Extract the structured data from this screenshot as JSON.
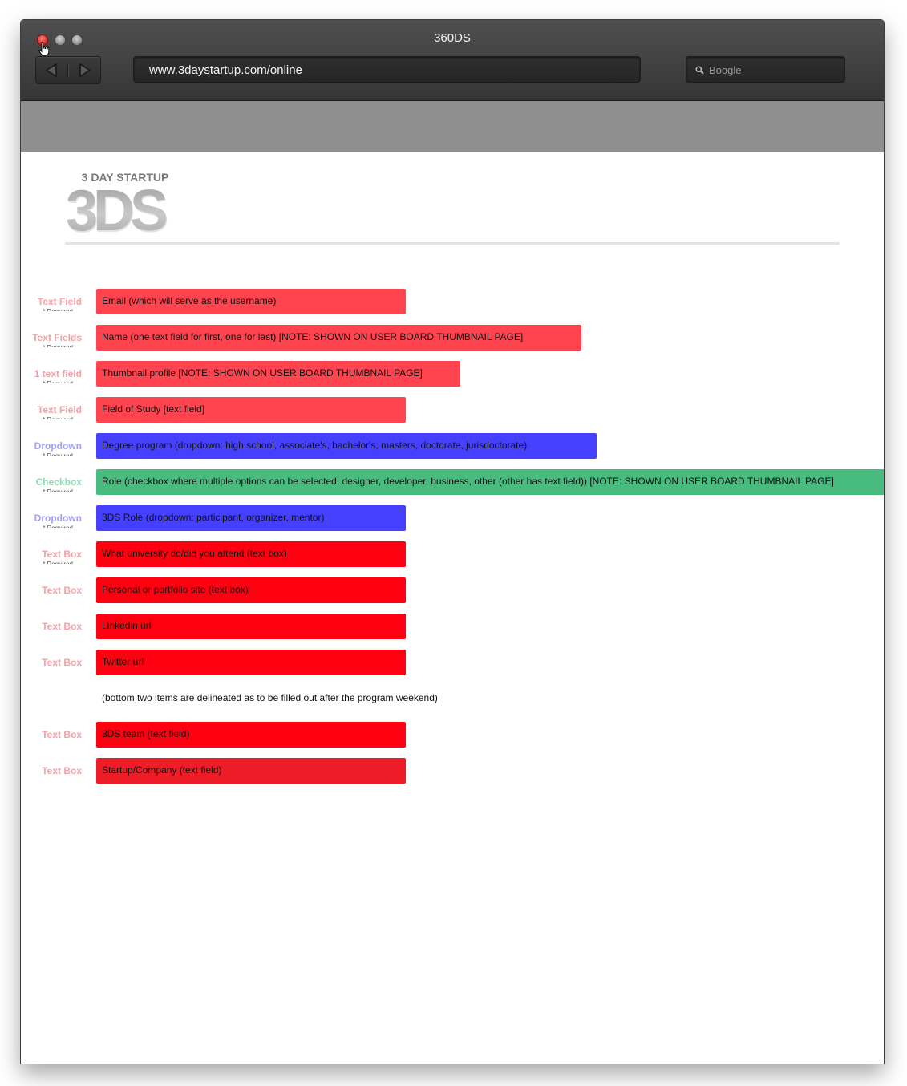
{
  "window": {
    "title": "360DS"
  },
  "toolbar": {
    "url": "www.3daystartup.com/online",
    "search_placeholder": "Boogle"
  },
  "logo": {
    "top_text": "3 DAY STARTUP",
    "main_text": "3DS"
  },
  "colors": {
    "red_light": "#ff4450",
    "red": "#ff0010",
    "red_dark": "#ee1c27",
    "blue": "#4540ff",
    "green": "#48bb7f",
    "label_red": "#f5a0a6",
    "label_blue": "#a4a0f6",
    "label_green": "#8fdcb0"
  },
  "form_fields": [
    {
      "type_label": "Text Field",
      "required": "* Required",
      "text": "Email (which will serve as the username)",
      "color": "#ff4450",
      "label_color": "#f5a0a6"
    },
    {
      "type_label": "Text Fields",
      "required": "* Required",
      "text": "Name (one text field for first, one for last) [NOTE: SHOWN ON USER BOARD THUMBNAIL PAGE]",
      "color": "#ff4450",
      "label_color": "#f5a0a6"
    },
    {
      "type_label": "1 text field",
      "required": "* Required",
      "text": "Thumbnail profile [NOTE: SHOWN ON USER BOARD THUMBNAIL PAGE]",
      "color": "#ff4450",
      "label_color": "#f5a0a6"
    },
    {
      "type_label": "Text Field",
      "required": "* Required",
      "text": "Field of Study [text field]",
      "color": "#ff4450",
      "label_color": "#f5a0a6"
    },
    {
      "type_label": "Dropdown",
      "required": "* Required",
      "text": "Degree program (dropdown: high school, associate's, bachelor's, masters, doctorate, jurisdoctorate)",
      "color": "#4540ff",
      "label_color": "#a4a0f6"
    },
    {
      "type_label": "Checkbox",
      "required": "* Required",
      "text": "Role (checkbox where multiple options can be selected: designer, developer, business, other (other has text field)) [NOTE: SHOWN ON USER BOARD THUMBNAIL PAGE]",
      "color": "#48bb7f",
      "label_color": "#8fdcb0"
    },
    {
      "type_label": "Dropdown",
      "required": "* Required",
      "text": "3DS Role (dropdown: participant, organizer, mentor)",
      "color": "#4540ff",
      "label_color": "#a4a0f6"
    },
    {
      "type_label": "Text Box",
      "required": "* Required",
      "text": "What university do/did you attend (text box)",
      "color": "#ff0010",
      "label_color": "#f5a0a6"
    },
    {
      "type_label": "Text Box",
      "required": "",
      "text": "Personal or portfolio site (text box)",
      "color": "#ff0010",
      "label_color": "#f5a0a6"
    },
    {
      "type_label": "Text Box",
      "required": "",
      "text": "Linkedin url",
      "color": "#ff0010",
      "label_color": "#f5a0a6"
    },
    {
      "type_label": "Text Box",
      "required": "",
      "text": "Twitter url",
      "color": "#ff0010",
      "label_color": "#f5a0a6"
    },
    {
      "note": "(bottom two items are delineated as to be filled out after the program weekend)"
    },
    {
      "type_label": "Text Box",
      "required": "",
      "text": "3DS team (text field)",
      "color": "#ff0010",
      "label_color": "#f5a0a6"
    },
    {
      "type_label": "Text Box",
      "required": "",
      "text": "Startup/Company (text field)",
      "color": "#ee1c27",
      "label_color": "#f5a0a6"
    }
  ]
}
